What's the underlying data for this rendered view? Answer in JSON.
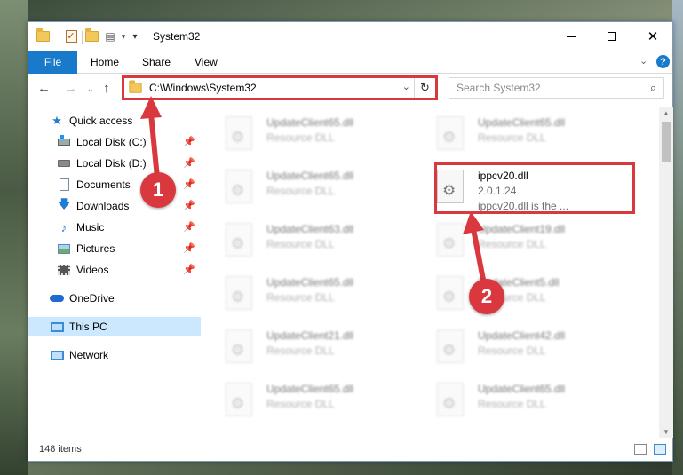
{
  "window": {
    "title": "System32"
  },
  "ribbon": {
    "tabs": [
      "File",
      "Home",
      "Share",
      "View"
    ]
  },
  "address": {
    "path": "C:\\Windows\\System32",
    "search_placeholder": "Search System32"
  },
  "navpane": {
    "items": [
      {
        "label": "Quick access",
        "icon": "star-icon"
      },
      {
        "label": "Local Disk (C:)",
        "icon": "drive-icon",
        "pinned": true
      },
      {
        "label": "Local Disk (D:)",
        "icon": "drive-icon",
        "pinned": true
      },
      {
        "label": "Documents",
        "icon": "document-icon",
        "pinned": true
      },
      {
        "label": "Downloads",
        "icon": "download-icon",
        "pinned": true
      },
      {
        "label": "Music",
        "icon": "music-icon",
        "pinned": true
      },
      {
        "label": "Pictures",
        "icon": "pictures-icon",
        "pinned": true
      },
      {
        "label": "Videos",
        "icon": "videos-icon",
        "pinned": true
      },
      {
        "label": "OneDrive",
        "icon": "cloud-icon"
      },
      {
        "label": "This PC",
        "icon": "computer-icon",
        "selected": true
      },
      {
        "label": "Network",
        "icon": "network-icon"
      }
    ]
  },
  "files": [
    {
      "name": "UpdateClient65.dll",
      "type": "Resource DLL"
    },
    {
      "name": "UpdateClient65.dll",
      "type": "Resource DLL"
    },
    {
      "name": "UpdateClient65.dll",
      "type": "Resource DLL"
    },
    {
      "name": "ippcv20.dll",
      "version": "2.0.1.24",
      "description": "ippcv20.dll is the ..."
    },
    {
      "name": "UpdateClient63.dll",
      "type": "Resource DLL"
    },
    {
      "name": "UpdateClient19.dll",
      "type": "Resource DLL"
    },
    {
      "name": "UpdateClient65.dll",
      "type": "Resource DLL"
    },
    {
      "name": "UpdateClient5.dll",
      "type": "Resource DLL"
    },
    {
      "name": "UpdateClient21.dll",
      "type": "Resource DLL"
    },
    {
      "name": "UpdateClient42.dll",
      "type": "Resource DLL"
    },
    {
      "name": "UpdateClient65.dll",
      "type": "Resource DLL"
    },
    {
      "name": "UpdateClient65.dll",
      "type": "Resource DLL"
    }
  ],
  "status": {
    "item_count": "148 items"
  },
  "callouts": [
    "1",
    "2"
  ],
  "colors": {
    "accent": "#1979ca",
    "highlight": "#d9383f",
    "selection": "#cce8ff"
  }
}
